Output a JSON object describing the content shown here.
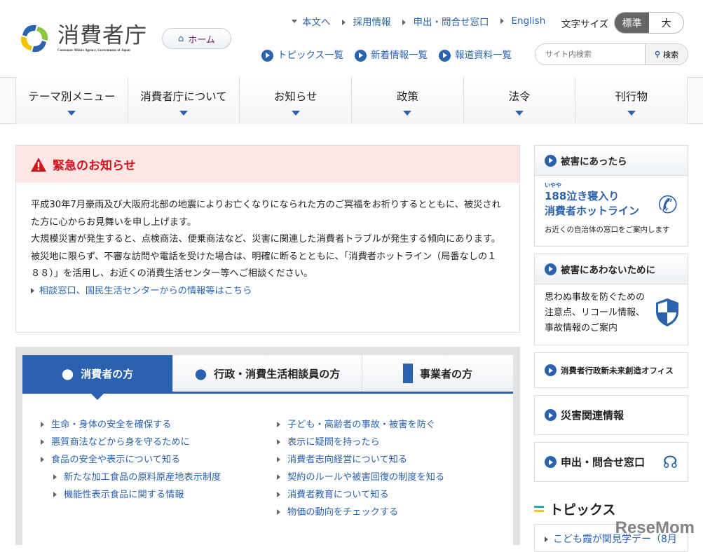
{
  "header": {
    "logo_text": "消費者庁",
    "logo_sub": "Consumer Affairs Agency, Government of Japan",
    "home": "ホーム",
    "top_links": [
      "本文へ",
      "採用情報",
      "申出・問合せ窓口",
      "English"
    ],
    "font_size_label": "文字サイズ",
    "font_sizes": [
      "標準",
      "大"
    ],
    "sub_links": [
      "トピックス一覧",
      "新着情報一覧",
      "報道資料一覧"
    ],
    "search_placeholder": "サイト内検索",
    "search_button": "検索"
  },
  "nav": [
    "テーマ別メニュー",
    "消費者庁について",
    "お知らせ",
    "政策",
    "法令",
    "刊行物"
  ],
  "alert": {
    "title": "緊急のお知らせ",
    "paragraphs": [
      "平成30年7月豪雨及び大阪府北部の地震によりお亡くなりになられた方のご冥福をお祈りするとともに、被災された方に心からお見舞いを申し上げます。",
      "大規模災害が発生すると、点検商法、便乗商法など、災害に関連した消費者トラブルが発生する傾向にあります。",
      "被災地に限らず、不審な訪問や電話を受けた場合は、明確に断るとともに、「消費者ホットライン（局番なしの１８８）」を活用し、お近くの消費生活センター等へご相談ください。"
    ],
    "link": "相談窓口、国民生活センターからの情報等はこちら"
  },
  "tabs": [
    "消費者の方",
    "行政・消費生活相談員の方",
    "事業者の方"
  ],
  "links_left": [
    {
      "t": "生命・身体の安全を確保する"
    },
    {
      "t": "悪質商法などから身を守るために"
    },
    {
      "t": "食品の安全や表示について知る"
    },
    {
      "t": "新たな加工食品の原料原産地表示制度",
      "sub": true
    },
    {
      "t": "機能性表示食品に関する情報",
      "sub": true
    }
  ],
  "links_right": [
    "子ども・高齢者の事故・被害を防ぐ",
    "表示に疑問を持ったら",
    "消費者志向経営について知る",
    "契約のルールや被害回復の制度を知る",
    "消費者教育について知る",
    "物価の動向をチェックする"
  ],
  "side": {
    "damage_title": "被害にあったら",
    "ruby": "いやや",
    "hotline1": "188泣き寝入り",
    "hotline2": "消費者ホットライン",
    "hotline_desc": "お近くの自治体の窓口をご案内します",
    "prevent_title": "被害にあわないために",
    "prevent_desc": "思わぬ事故を防ぐための注意点、リコール情報、事故情報のご案内",
    "office": "消費者行政新未来創造オフィス",
    "disaster": "災害関連情報",
    "contact": "申出・問合せ窓口"
  },
  "topics": {
    "title": "トピックス",
    "item": "こども霞が関見学デー（8月"
  },
  "watermark": "ReseMom"
}
